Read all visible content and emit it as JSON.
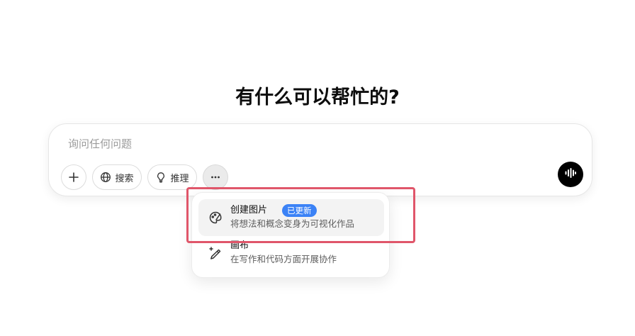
{
  "headline": "有什么可以帮忙的?",
  "composer": {
    "placeholder": "询问任何问题",
    "add_icon": "plus-icon",
    "search_label": "搜索",
    "search_icon": "globe-icon",
    "reason_label": "推理",
    "reason_icon": "lightbulb-icon",
    "more_icon": "ellipsis-icon",
    "voice_icon": "voice-waveform-icon"
  },
  "tools_menu": {
    "items": [
      {
        "title": "创建图片",
        "badge": "已更新",
        "description": "将想法和概念变身为可视化作品",
        "icon": "palette-icon",
        "highlighted": true
      },
      {
        "title": "画布",
        "description": "在写作和代码方面开展协作",
        "icon": "pencil-sparkle-icon"
      }
    ]
  },
  "colors": {
    "badge": "#3b82f6",
    "highlight_outline": "#e0566a",
    "voice_button": "#000000"
  }
}
